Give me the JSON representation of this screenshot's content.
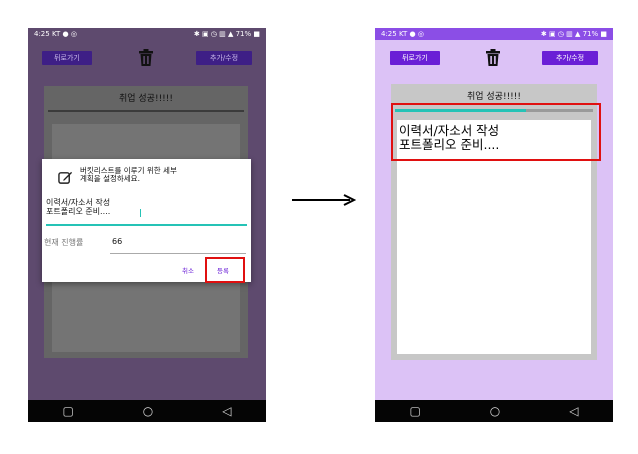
{
  "status": {
    "time": "4:25",
    "carrier": "KT",
    "battery": "71%"
  },
  "toolbar": {
    "back_label": "뒤로가기",
    "add_edit_label": "추가/수정"
  },
  "card": {
    "title": "취업 성공!!!!!"
  },
  "dialog": {
    "description": "버킷리스트를 이루기 위한 세부\n계획을 설정하세요.",
    "plan_value": "이력서/자소서 작성\n포트폴리오 준비....",
    "progress_label": "현재 진행률",
    "progress_value": "66",
    "cancel_label": "취소",
    "register_label": "등록"
  },
  "result": {
    "plan_text": "이력서/자소서 작성\n포트폴리오 준비....",
    "progress_fraction": 0.66
  },
  "nav": {
    "recent_glyph": "▢",
    "home_glyph": "○",
    "back_glyph": "◁"
  },
  "colors": {
    "accent": "#6a1fd6",
    "progress": "#25c3b6",
    "highlight": "#e01010",
    "dimmed_background": "#5e4a6e",
    "light_background": "#dcc2f6"
  }
}
